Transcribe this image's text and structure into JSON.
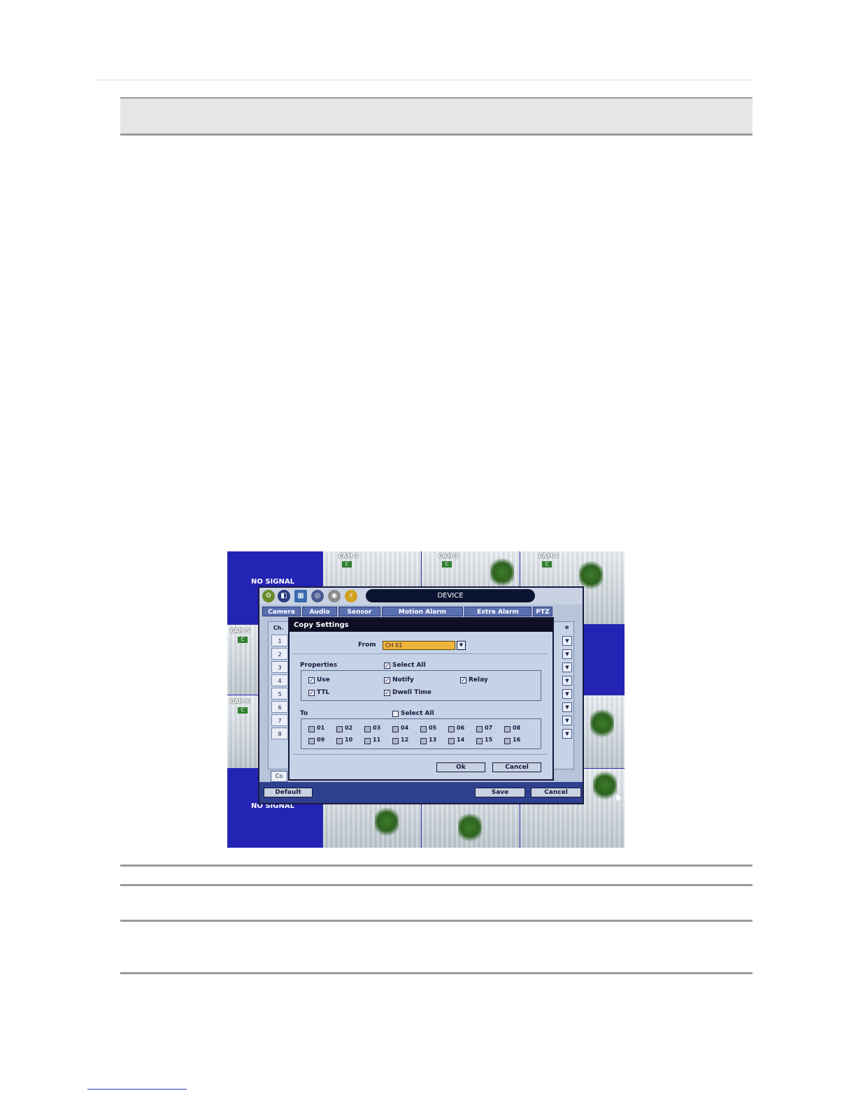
{
  "screen": {
    "no_signal": "NO SIGNAL",
    "cameras": [
      "CAM 2",
      "CAM 3",
      "CAM 4",
      "CAM 5",
      "CAM 6"
    ],
    "badge": "C"
  },
  "dvr": {
    "title": "DEVICE",
    "tabs": [
      "Camera",
      "Audio",
      "Sensor",
      "Motion Alarm",
      "Extra Alarm",
      "PTZ"
    ],
    "ch_header": "Ch.",
    "channels": [
      "1",
      "2",
      "3",
      "4",
      "5",
      "6",
      "7",
      "8"
    ],
    "side_header_fragment": "e",
    "partial_button": "Co",
    "buttons": {
      "default": "Default",
      "save": "Save",
      "cancel": "Cancel"
    }
  },
  "dialog": {
    "title": "Copy Settings",
    "from_label": "From",
    "from_value": "CH 01",
    "properties_label": "Properties",
    "select_all": "Select All",
    "properties": [
      {
        "label": "Use",
        "checked": true
      },
      {
        "label": "Notify",
        "checked": true
      },
      {
        "label": "Relay",
        "checked": true
      },
      {
        "label": "TTL",
        "checked": true
      },
      {
        "label": "Dwell Time",
        "checked": true
      }
    ],
    "to_label": "To",
    "to_channels": [
      "01",
      "02",
      "03",
      "04",
      "05",
      "06",
      "07",
      "08",
      "09",
      "10",
      "11",
      "12",
      "13",
      "14",
      "15",
      "16"
    ],
    "ok": "Ok",
    "cancel": "Cancel"
  },
  "colors": {
    "screen_blue": "#2424b4",
    "dialog_bg": "#c6d2e6",
    "title_bar": "#0e0f24",
    "from_select": "#f0b43a"
  }
}
